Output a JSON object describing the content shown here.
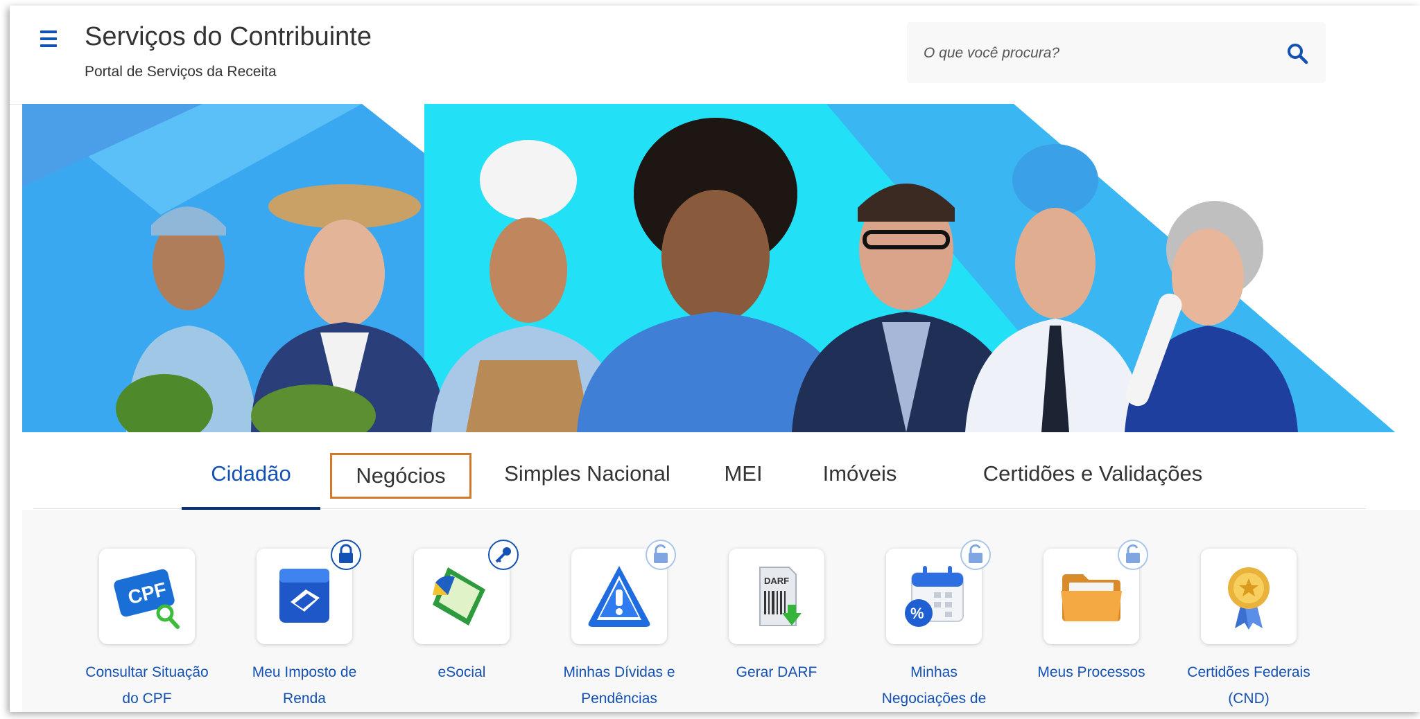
{
  "header": {
    "title": "Serviços do Contribuinte",
    "subtitle": "Portal de Serviços da Receita",
    "search_placeholder": "O que você procura?"
  },
  "tabs": [
    {
      "label": "Cidadão",
      "state": "active"
    },
    {
      "label": "Negócios",
      "state": "highlighted"
    },
    {
      "label": "Simples Nacional"
    },
    {
      "label": "MEI"
    },
    {
      "label": "Imóveis"
    },
    {
      "label": "Certidões e Validações"
    }
  ],
  "services": [
    {
      "label_line1": "Consultar Situação",
      "label_line2": "do CPF",
      "icon": "cpf-card-icon",
      "badge": "none"
    },
    {
      "label_line1": "Meu Imposto de",
      "label_line2": "Renda",
      "icon": "income-tax-icon",
      "badge": "lock-closed"
    },
    {
      "label_line1": "eSocial",
      "label_line2": "",
      "icon": "esocial-icon",
      "badge": "key"
    },
    {
      "label_line1": "Minhas Dívidas e",
      "label_line2": "Pendências",
      "icon": "warning-icon",
      "badge": "lock-open"
    },
    {
      "label_line1": "Gerar DARF",
      "label_line2": "",
      "icon": "darf-document-icon",
      "badge": "none"
    },
    {
      "label_line1": "Minhas",
      "label_line2": "Negociações de",
      "icon": "calendar-percent-icon",
      "badge": "lock-open"
    },
    {
      "label_line1": "Meus Processos",
      "label_line2": "",
      "icon": "folder-icon",
      "badge": "lock-open"
    },
    {
      "label_line1": "Certidões Federais",
      "label_line2": "(CND)",
      "icon": "medal-icon",
      "badge": "none"
    }
  ],
  "colors": {
    "primary": "#1351b4",
    "tab_underline": "#0c326f",
    "highlight_border": "#d2792b",
    "banner_cyan": "#22e0f5",
    "banner_blue": "#3aa8f0"
  }
}
